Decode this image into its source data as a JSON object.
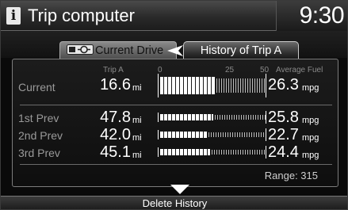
{
  "header": {
    "info_glyph": "i",
    "title": "Trip computer",
    "clock": "9:30"
  },
  "tabs": [
    {
      "label": "Current Drive",
      "selected": false,
      "icon": "car-steering-icon"
    },
    {
      "label": "History of Trip A",
      "selected": true
    }
  ],
  "columns": {
    "trip": "Trip A",
    "scale_min": "0",
    "scale_mid": "25",
    "scale_max": "50",
    "fuel": "Average Fuel"
  },
  "rows": [
    {
      "label": "Current",
      "distance": "16.6",
      "distance_unit": "mi",
      "fuel": "26.3",
      "fuel_unit": "mpg",
      "fuel_value": 26.3
    },
    {
      "label": "1st Prev",
      "distance": "47.8",
      "distance_unit": "mi",
      "fuel": "25.8",
      "fuel_unit": "mpg",
      "fuel_value": 25.8
    },
    {
      "label": "2nd Prev",
      "distance": "42.0",
      "distance_unit": "mi",
      "fuel": "22.7",
      "fuel_unit": "mpg",
      "fuel_value": 22.7
    },
    {
      "label": "3rd Prev",
      "distance": "45.1",
      "distance_unit": "mi",
      "fuel": "24.4",
      "fuel_unit": "mpg",
      "fuel_value": 24.4
    }
  ],
  "range_text": "Range: 315",
  "footer": {
    "delete_label": "Delete History"
  },
  "colors": {
    "background": "#0a0a0a",
    "text": "#ffffff",
    "muted": "#9a9a9a",
    "panel_border": "#7c7c7c"
  }
}
